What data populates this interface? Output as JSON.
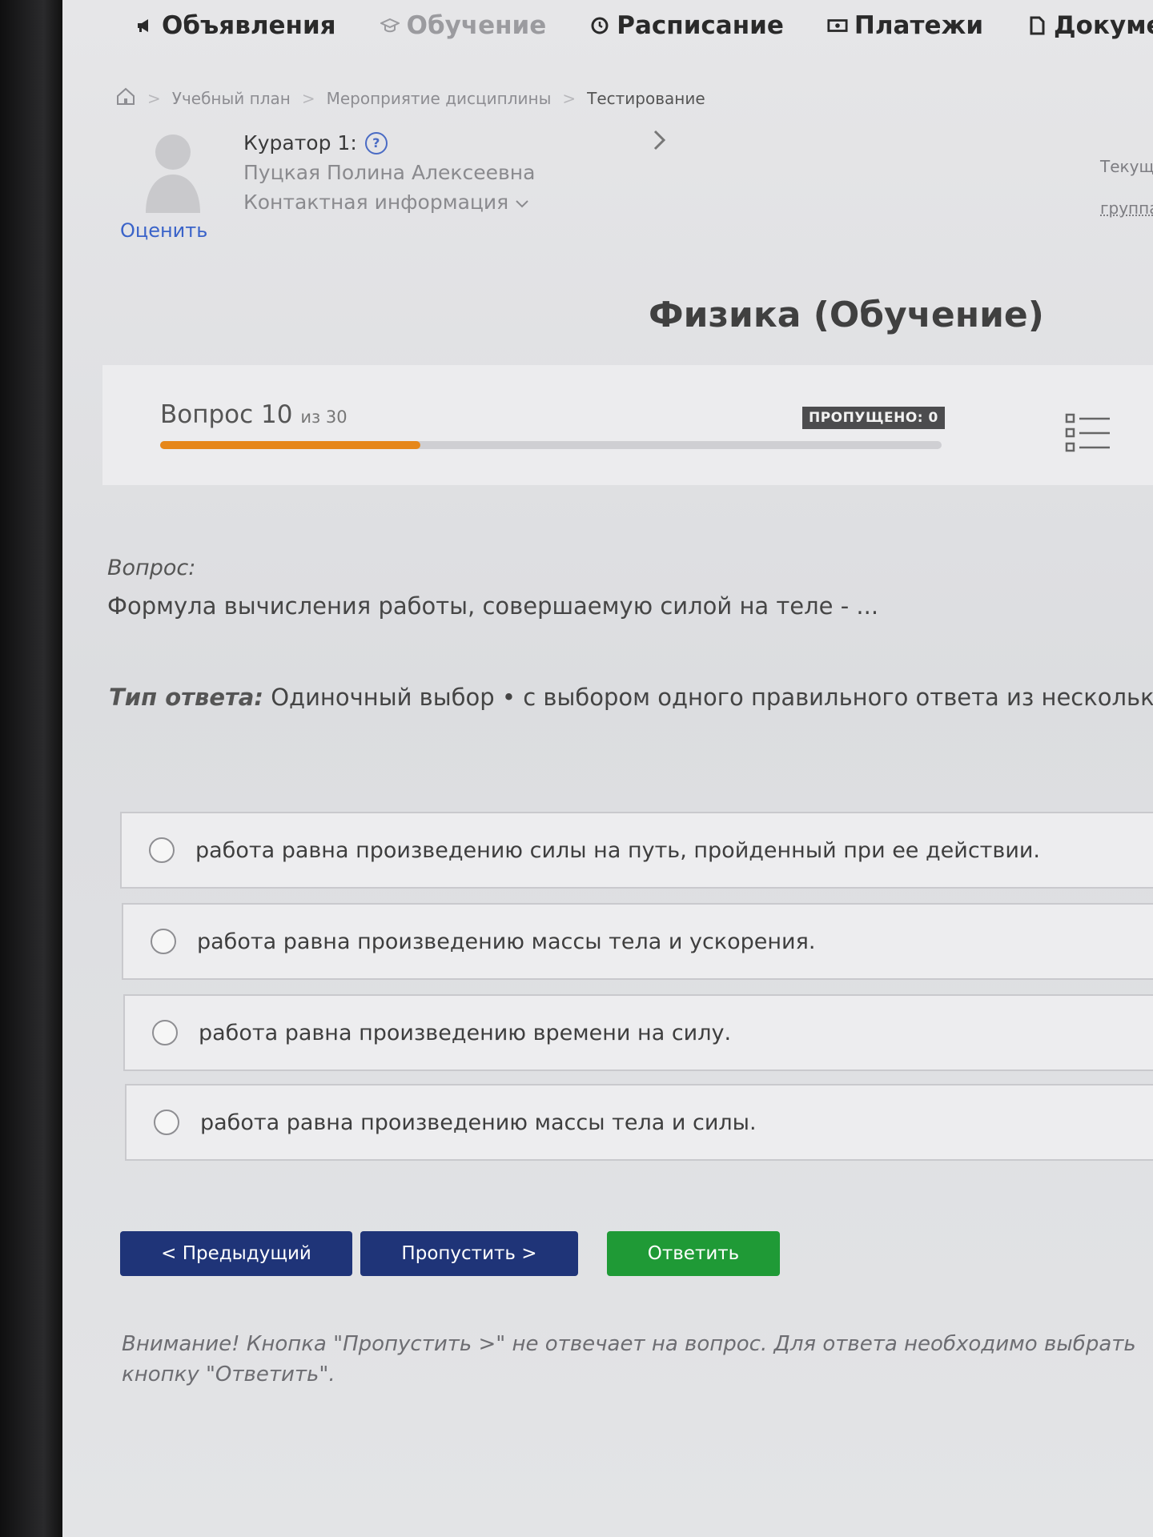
{
  "nav": {
    "items": [
      {
        "label": "Объявления",
        "icon": "megaphone-icon"
      },
      {
        "label": "Обучение",
        "icon": "graduation-cap-icon"
      },
      {
        "label": "Расписание",
        "icon": "clock-icon"
      },
      {
        "label": "Платежи",
        "icon": "money-icon"
      },
      {
        "label": "Докумен",
        "icon": "document-icon"
      }
    ]
  },
  "breadcrumb": {
    "items": [
      "Учебный план",
      "Мероприятие дисциплины",
      "Тестирование"
    ]
  },
  "curator": {
    "title": "Куратор 1:",
    "help": "?",
    "name": "Пуцкая Полина Алексеевна",
    "contact": "Контактная информация",
    "rate_link": "Оценить"
  },
  "right_panel": {
    "current": "Текуща",
    "group": "группа"
  },
  "course_title": "Физика (Обучение)",
  "progress": {
    "question_label": "Вопрос 10",
    "of_label": "из 30",
    "current": 10,
    "total": 30,
    "skipped_badge": "ПРОПУЩЕНО: 0",
    "accent": "#e6871a"
  },
  "question": {
    "label": "Вопрос:",
    "text": "Формула вычисления работы, совершаемую силой на теле - ...",
    "answer_type_label": "Тип ответа:",
    "answer_type_value": "Одиночный выбор • с выбором одного правильного ответа из нескольких предло"
  },
  "options": [
    "работа равна произведению силы на путь, пройденный при ее действии.",
    "работа равна произведению массы тела и ускорения.",
    "работа равна произведению времени на силу.",
    "работа равна произведению массы тела и силы."
  ],
  "buttons": {
    "prev": "< Предыдущий",
    "skip": "Пропустить >",
    "answer": "Ответить",
    "colors": {
      "navy": "#1f3478",
      "green": "#1f9a36"
    }
  },
  "warning": {
    "line1": "Внимание! Кнопка \"Пропустить >\" не отвечает на вопрос. Для ответа необходимо выбрать",
    "line2": "кнопку \"Ответить\"."
  }
}
